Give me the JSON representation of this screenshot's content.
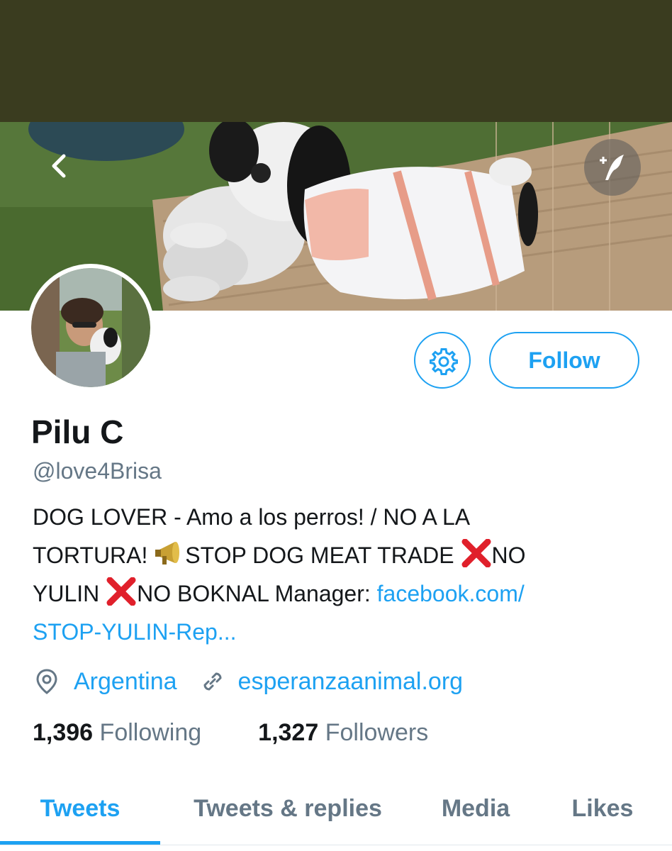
{
  "profile": {
    "name": "Pilu C",
    "handle": "@love4Brisa",
    "bio": {
      "line1": "DOG LOVER - Amo a los perros! / NO A LA",
      "line2a": "TORTURA! ",
      "line2b": "STOP DOG MEAT TRADE ",
      "line2c": "NO",
      "line3a": "YULIN ",
      "line3b": "NO BOKNAL Manager: ",
      "line3link": "facebook.com/",
      "line4link": "STOP-YULIN-Rep..."
    },
    "location": "Argentina",
    "website": "esperanzaanimal.org"
  },
  "buttons": {
    "follow_label": "Follow"
  },
  "stats": {
    "following_count": "1,396",
    "following_label": "Following",
    "followers_count": "1,327",
    "followers_label": "Followers"
  },
  "tabs": [
    {
      "label": "Tweets",
      "active": true
    },
    {
      "label": "Tweets & replies",
      "active": false
    },
    {
      "label": "Media",
      "active": false
    },
    {
      "label": "Likes",
      "active": false
    }
  ],
  "icons": {
    "back": "chevron-left-icon",
    "compose": "compose-icon",
    "settings": "gear-icon",
    "location": "location-pin-icon",
    "link": "link-icon",
    "megaphone": "megaphone-icon",
    "cross": "cross-mark-icon"
  },
  "colors": {
    "accent": "#1da1f2",
    "secondary_text": "#657786",
    "primary_text": "#14171a",
    "top_bar": "#3a3c1f"
  }
}
